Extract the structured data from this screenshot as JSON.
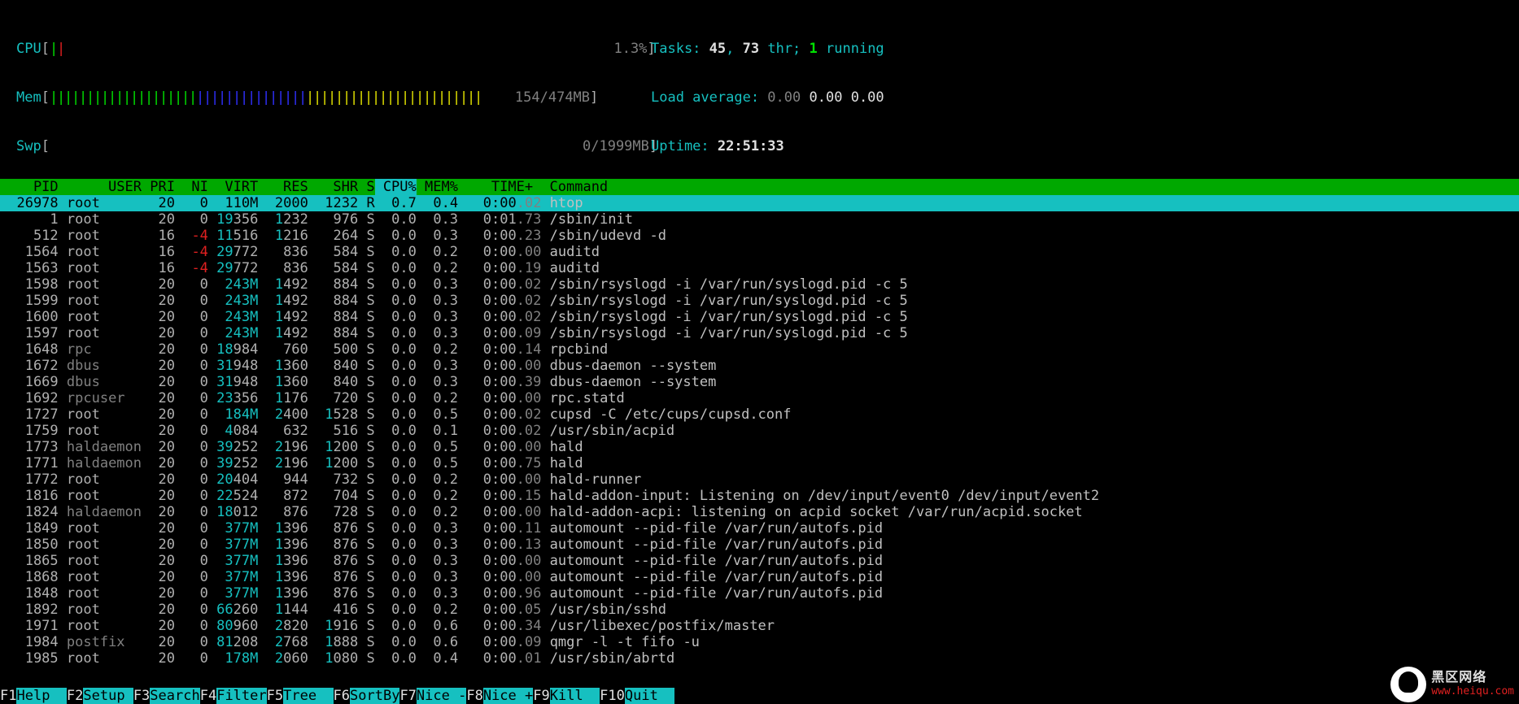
{
  "meters": {
    "cpu": {
      "label": "CPU",
      "bars": "||",
      "value": "1.3%"
    },
    "mem": {
      "label": "Mem",
      "bars_count": 59,
      "value": "154/474MB"
    },
    "swp": {
      "label": "Swp",
      "bars_count": 0,
      "value": "0/1999MB"
    }
  },
  "stats": {
    "tasks_label": "Tasks: ",
    "tasks": "45",
    "tasks_sep": ", ",
    "threads": "73",
    "threads_suffix": " thr; ",
    "running": "1",
    "running_suffix": " running",
    "load_label": "Load average: ",
    "load1": "0.00",
    "load2": "0.00",
    "load3": "0.00",
    "uptime_label": "Uptime: ",
    "uptime": "22:51:33"
  },
  "columns": [
    "PID",
    "USER",
    "PRI",
    "NI",
    "VIRT",
    "RES",
    "SHR",
    "S",
    "CPU%",
    "MEM%",
    "TIME+",
    "Command"
  ],
  "sort_col": "CPU%",
  "processes": [
    {
      "pid": "26978",
      "user": "root",
      "pri": "20",
      "ni": "0",
      "virt": "110M",
      "res": "2000",
      "shr": "1232",
      "s": "R",
      "cpu": "0.7",
      "mem": "0.4",
      "time": "0:00.02",
      "cmd": "htop",
      "sel": true
    },
    {
      "pid": "1",
      "user": "root",
      "pri": "20",
      "ni": "0",
      "virt": "19356",
      "res": "1232",
      "shr": "976",
      "s": "S",
      "cpu": "0.0",
      "mem": "0.3",
      "time": "0:01.73",
      "cmd": "/sbin/init"
    },
    {
      "pid": "512",
      "user": "root",
      "pri": "16",
      "ni": "-4",
      "virt": "11516",
      "res": "1216",
      "shr": "264",
      "s": "S",
      "cpu": "0.0",
      "mem": "0.3",
      "time": "0:00.23",
      "cmd": "/sbin/udevd -d"
    },
    {
      "pid": "1564",
      "user": "root",
      "pri": "16",
      "ni": "-4",
      "virt": "29772",
      "res": "836",
      "shr": "584",
      "s": "S",
      "cpu": "0.0",
      "mem": "0.2",
      "time": "0:00.00",
      "cmd": "auditd"
    },
    {
      "pid": "1563",
      "user": "root",
      "pri": "16",
      "ni": "-4",
      "virt": "29772",
      "res": "836",
      "shr": "584",
      "s": "S",
      "cpu": "0.0",
      "mem": "0.2",
      "time": "0:00.19",
      "cmd": "auditd"
    },
    {
      "pid": "1598",
      "user": "root",
      "pri": "20",
      "ni": "0",
      "virt": "243M",
      "res": "1492",
      "shr": "884",
      "s": "S",
      "cpu": "0.0",
      "mem": "0.3",
      "time": "0:00.02",
      "cmd": "/sbin/rsyslogd -i /var/run/syslogd.pid -c 5"
    },
    {
      "pid": "1599",
      "user": "root",
      "pri": "20",
      "ni": "0",
      "virt": "243M",
      "res": "1492",
      "shr": "884",
      "s": "S",
      "cpu": "0.0",
      "mem": "0.3",
      "time": "0:00.02",
      "cmd": "/sbin/rsyslogd -i /var/run/syslogd.pid -c 5"
    },
    {
      "pid": "1600",
      "user": "root",
      "pri": "20",
      "ni": "0",
      "virt": "243M",
      "res": "1492",
      "shr": "884",
      "s": "S",
      "cpu": "0.0",
      "mem": "0.3",
      "time": "0:00.02",
      "cmd": "/sbin/rsyslogd -i /var/run/syslogd.pid -c 5"
    },
    {
      "pid": "1597",
      "user": "root",
      "pri": "20",
      "ni": "0",
      "virt": "243M",
      "res": "1492",
      "shr": "884",
      "s": "S",
      "cpu": "0.0",
      "mem": "0.3",
      "time": "0:00.09",
      "cmd": "/sbin/rsyslogd -i /var/run/syslogd.pid -c 5"
    },
    {
      "pid": "1648",
      "user": "rpc",
      "pri": "20",
      "ni": "0",
      "virt": "18984",
      "res": "760",
      "shr": "500",
      "s": "S",
      "cpu": "0.0",
      "mem": "0.2",
      "time": "0:00.14",
      "cmd": "rpcbind"
    },
    {
      "pid": "1672",
      "user": "dbus",
      "pri": "20",
      "ni": "0",
      "virt": "31948",
      "res": "1360",
      "shr": "840",
      "s": "S",
      "cpu": "0.0",
      "mem": "0.3",
      "time": "0:00.00",
      "cmd": "dbus-daemon --system"
    },
    {
      "pid": "1669",
      "user": "dbus",
      "pri": "20",
      "ni": "0",
      "virt": "31948",
      "res": "1360",
      "shr": "840",
      "s": "S",
      "cpu": "0.0",
      "mem": "0.3",
      "time": "0:00.39",
      "cmd": "dbus-daemon --system"
    },
    {
      "pid": "1692",
      "user": "rpcuser",
      "pri": "20",
      "ni": "0",
      "virt": "23356",
      "res": "1176",
      "shr": "720",
      "s": "S",
      "cpu": "0.0",
      "mem": "0.2",
      "time": "0:00.00",
      "cmd": "rpc.statd"
    },
    {
      "pid": "1727",
      "user": "root",
      "pri": "20",
      "ni": "0",
      "virt": "184M",
      "res": "2400",
      "shr": "1528",
      "s": "S",
      "cpu": "0.0",
      "mem": "0.5",
      "time": "0:00.02",
      "cmd": "cupsd -C /etc/cups/cupsd.conf"
    },
    {
      "pid": "1759",
      "user": "root",
      "pri": "20",
      "ni": "0",
      "virt": "4084",
      "res": "632",
      "shr": "516",
      "s": "S",
      "cpu": "0.0",
      "mem": "0.1",
      "time": "0:00.02",
      "cmd": "/usr/sbin/acpid"
    },
    {
      "pid": "1773",
      "user": "haldaemon",
      "pri": "20",
      "ni": "0",
      "virt": "39252",
      "res": "2196",
      "shr": "1200",
      "s": "S",
      "cpu": "0.0",
      "mem": "0.5",
      "time": "0:00.00",
      "cmd": "hald"
    },
    {
      "pid": "1771",
      "user": "haldaemon",
      "pri": "20",
      "ni": "0",
      "virt": "39252",
      "res": "2196",
      "shr": "1200",
      "s": "S",
      "cpu": "0.0",
      "mem": "0.5",
      "time": "0:00.75",
      "cmd": "hald"
    },
    {
      "pid": "1772",
      "user": "root",
      "pri": "20",
      "ni": "0",
      "virt": "20404",
      "res": "944",
      "shr": "732",
      "s": "S",
      "cpu": "0.0",
      "mem": "0.2",
      "time": "0:00.00",
      "cmd": "hald-runner"
    },
    {
      "pid": "1816",
      "user": "root",
      "pri": "20",
      "ni": "0",
      "virt": "22524",
      "res": "872",
      "shr": "704",
      "s": "S",
      "cpu": "0.0",
      "mem": "0.2",
      "time": "0:00.15",
      "cmd": "hald-addon-input: Listening on /dev/input/event0 /dev/input/event2"
    },
    {
      "pid": "1824",
      "user": "haldaemon",
      "pri": "20",
      "ni": "0",
      "virt": "18012",
      "res": "876",
      "shr": "728",
      "s": "S",
      "cpu": "0.0",
      "mem": "0.2",
      "time": "0:00.00",
      "cmd": "hald-addon-acpi: listening on acpid socket /var/run/acpid.socket"
    },
    {
      "pid": "1849",
      "user": "root",
      "pri": "20",
      "ni": "0",
      "virt": "377M",
      "res": "1396",
      "shr": "876",
      "s": "S",
      "cpu": "0.0",
      "mem": "0.3",
      "time": "0:00.11",
      "cmd": "automount --pid-file /var/run/autofs.pid"
    },
    {
      "pid": "1850",
      "user": "root",
      "pri": "20",
      "ni": "0",
      "virt": "377M",
      "res": "1396",
      "shr": "876",
      "s": "S",
      "cpu": "0.0",
      "mem": "0.3",
      "time": "0:00.13",
      "cmd": "automount --pid-file /var/run/autofs.pid"
    },
    {
      "pid": "1865",
      "user": "root",
      "pri": "20",
      "ni": "0",
      "virt": "377M",
      "res": "1396",
      "shr": "876",
      "s": "S",
      "cpu": "0.0",
      "mem": "0.3",
      "time": "0:00.00",
      "cmd": "automount --pid-file /var/run/autofs.pid"
    },
    {
      "pid": "1868",
      "user": "root",
      "pri": "20",
      "ni": "0",
      "virt": "377M",
      "res": "1396",
      "shr": "876",
      "s": "S",
      "cpu": "0.0",
      "mem": "0.3",
      "time": "0:00.00",
      "cmd": "automount --pid-file /var/run/autofs.pid"
    },
    {
      "pid": "1848",
      "user": "root",
      "pri": "20",
      "ni": "0",
      "virt": "377M",
      "res": "1396",
      "shr": "876",
      "s": "S",
      "cpu": "0.0",
      "mem": "0.3",
      "time": "0:00.96",
      "cmd": "automount --pid-file /var/run/autofs.pid"
    },
    {
      "pid": "1892",
      "user": "root",
      "pri": "20",
      "ni": "0",
      "virt": "66260",
      "res": "1144",
      "shr": "416",
      "s": "S",
      "cpu": "0.0",
      "mem": "0.2",
      "time": "0:00.05",
      "cmd": "/usr/sbin/sshd"
    },
    {
      "pid": "1971",
      "user": "root",
      "pri": "20",
      "ni": "0",
      "virt": "80960",
      "res": "2820",
      "shr": "1916",
      "s": "S",
      "cpu": "0.0",
      "mem": "0.6",
      "time": "0:00.34",
      "cmd": "/usr/libexec/postfix/master"
    },
    {
      "pid": "1984",
      "user": "postfix",
      "pri": "20",
      "ni": "0",
      "virt": "81208",
      "res": "2768",
      "shr": "1888",
      "s": "S",
      "cpu": "0.0",
      "mem": "0.6",
      "time": "0:00.09",
      "cmd": "qmgr -l -t fifo -u"
    },
    {
      "pid": "1985",
      "user": "root",
      "pri": "20",
      "ni": "0",
      "virt": "178M",
      "res": "2060",
      "shr": "1080",
      "s": "S",
      "cpu": "0.0",
      "mem": "0.4",
      "time": "0:00.01",
      "cmd": "/usr/sbin/abrtd"
    }
  ],
  "footer": [
    {
      "key": "F1",
      "label": "Help  "
    },
    {
      "key": "F2",
      "label": "Setup "
    },
    {
      "key": "F3",
      "label": "Search"
    },
    {
      "key": "F4",
      "label": "Filter"
    },
    {
      "key": "F5",
      "label": "Tree  "
    },
    {
      "key": "F6",
      "label": "SortBy"
    },
    {
      "key": "F7",
      "label": "Nice -"
    },
    {
      "key": "F8",
      "label": "Nice +"
    },
    {
      "key": "F9",
      "label": "Kill  "
    },
    {
      "key": "F10",
      "label": "Quit  "
    }
  ],
  "watermark": {
    "line1": "黑区网络",
    "line2": "www.heiqu.com"
  }
}
